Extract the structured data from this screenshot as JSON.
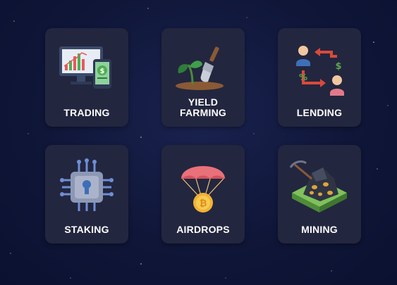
{
  "tiles": [
    {
      "id": "trading",
      "label": "TRADING",
      "icon": "chart-monitor-icon"
    },
    {
      "id": "yield-farming",
      "label_line1": "YIELD",
      "label_line2": "FARMING",
      "icon": "sprout-trowel-icon"
    },
    {
      "id": "lending",
      "label": "LENDING",
      "icon": "lending-exchange-icon"
    },
    {
      "id": "staking",
      "label": "STAKING",
      "icon": "chip-lock-icon"
    },
    {
      "id": "airdrops",
      "label": "AIRDROPS",
      "icon": "parachute-coin-icon"
    },
    {
      "id": "mining",
      "label": "MINING",
      "icon": "pickaxe-ore-icon"
    }
  ],
  "colors": {
    "background": "#0f1638",
    "tile": "#23263f",
    "text": "#ffffff"
  }
}
